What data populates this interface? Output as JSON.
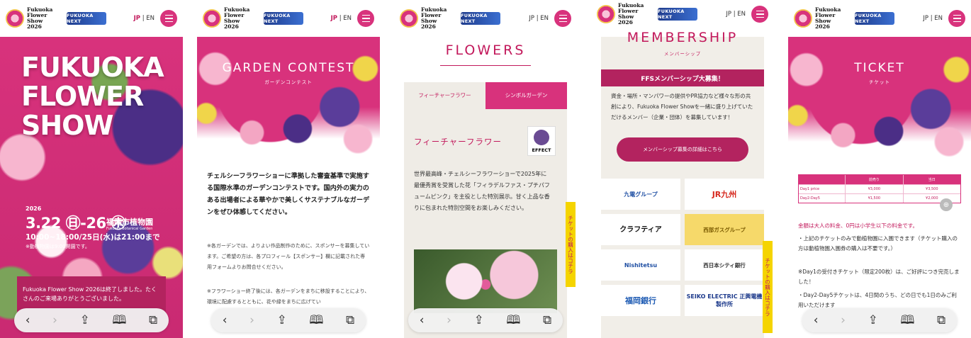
{
  "header": {
    "logo_line1": "Fukuoka",
    "logo_line2": "Flower Show",
    "logo_line3": "2026",
    "next_logo": "FUKUOKA NEXT",
    "lang_jp": "JP",
    "lang_sep": "|",
    "lang_en": "EN"
  },
  "bottom_bar": {
    "back": "‹",
    "forward": "›",
    "share": "⇪",
    "bookmarks": "🕮",
    "tabs": "⧉"
  },
  "hero": {
    "title_lines": [
      "FUKUOKA",
      "FLOWER",
      "SHOW"
    ],
    "year": "2026",
    "dates": "3.22 ㊐-26 ㊍",
    "venue": "福岡市植物園",
    "venue_en": "Fukuoka Botanical Garden",
    "hours": "10:00~18:00/25日(水)は21:00まで",
    "note": "※動植物園は9:00開園です。",
    "ended_text": "Fukuoka Flower Show 2026は終了しました。たくさんのご来場ありがとうございました。"
  },
  "garden": {
    "title": "GARDEN CONTEST",
    "subtitle": "ガーデンコンテスト",
    "para": "チェルシーフラワーショーに準拠した審査基準で実施する国際水準のガーデンコンテストです。国内外の実力のある出場者による華やかで美しくサステナブルなガーデンをぜひ体感してください。",
    "note1": "※各ガーデンでは、よりよい作品制作のために、スポンサーを募集しています。ご希望の方は、各プロフィール【スポンサー】欄に記載された専用フォームよりお問合せください。",
    "note2": "※フラワーショー終了後には、各ガーデンをまちに移設することにより、環境に配慮するとともに、花や緑をまちに広げてい"
  },
  "flowers": {
    "title": "FLOWERS",
    "tab1": "フィーチャーフラワー",
    "tab2": "シンボルガーデン",
    "heading": "フィーチャーフラワー",
    "effect": "EFFECT",
    "desc": "世界最高峰・チェルシーフラワーショーで2025年に最優秀賞を受賞した花「フィラデルファス・プチパフュームピンク」を主役とした特別展示。甘く上品な香りに包まれた特別空間をお楽しみください。",
    "ticket_banner": "チケットの購入はコチラ"
  },
  "membership": {
    "title": "MEMBERSHIP",
    "subtitle": "メンバーシップ",
    "recruit": "FFSメンバーシップ大募集！",
    "text": "資金・場所・マンパワーの提供やPR協力など様々な形の共創により、Fukuoka Flower Showを一緒に盛り上げていただけるメンバー（企業・団体）を募集しています！",
    "button": "メンバーシップ募集の詳細はこちら",
    "sponsors": [
      "九電グループ",
      "JR九州",
      "クラフティア",
      "西部ガスグループ",
      "Nishitetsu",
      "西日本シティ銀行",
      "福岡銀行",
      "SEIKO ELECTRIC 正興電機製作所"
    ],
    "ticket_banner": "チケットの購入はコチラ"
  },
  "ticket": {
    "title": "TICKET",
    "subtitle": "チケット",
    "table_header": [
      "",
      "前売り",
      "当日"
    ],
    "table_rows": [
      [
        "Day1 price",
        "¥3,000",
        "¥3,500"
      ],
      [
        "Day2-Day5",
        "¥1,500",
        "¥2,000"
      ]
    ],
    "note_pink": "金額は大人の料金、0円は小学生以下の料金です。",
    "note1": "・上記のチケットのみで動植物園に入園できます（チケット購入の方は動植物園入園券の購入は不要です。）",
    "note2": "※Day1の受付きチケット（限定200枚）は、ご好評につき完売しました！",
    "note3": "・Day2-Day5チケットは、4日間のうち、どの日でも1日のみご利用いただけます"
  },
  "colors": {
    "accent": "#d8327c",
    "dark_accent": "#b3235f",
    "banner": "#f5d400"
  }
}
